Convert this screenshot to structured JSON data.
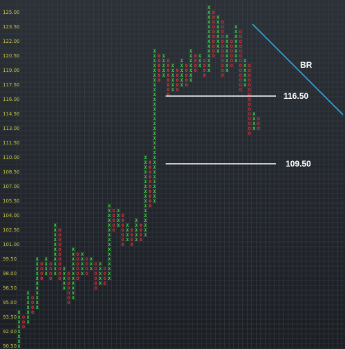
{
  "chart_data": {
    "type": "point-and-figure",
    "title": "",
    "box_size": 0.5,
    "y_ticks": [
      "125.00",
      "123.50",
      "122.00",
      "120.50",
      "119.00",
      "117.50",
      "116.00",
      "114.50",
      "113.00",
      "111.50",
      "110.00",
      "108.50",
      "107.00",
      "105.50",
      "104.00",
      "102.50",
      "101.00",
      "99.50",
      "98.00",
      "96.50",
      "95.00",
      "93.50",
      "92.00",
      "90.50"
    ],
    "columns": [
      {
        "type": "X",
        "low": 90.5,
        "high": 94.0
      },
      {
        "type": "O",
        "low": 92.5,
        "high": 93.5
      },
      {
        "type": "X",
        "low": 93.0,
        "high": 96.0
      },
      {
        "type": "O",
        "low": 94.0,
        "high": 95.5
      },
      {
        "type": "X",
        "low": 94.5,
        "high": 99.5
      },
      {
        "type": "O",
        "low": 97.5,
        "high": 99.0
      },
      {
        "type": "X",
        "low": 98.0,
        "high": 99.5
      },
      {
        "type": "O",
        "low": 97.5,
        "high": 99.0
      },
      {
        "type": "X",
        "low": 98.0,
        "high": 103.0
      },
      {
        "type": "O",
        "low": 97.5,
        "high": 102.5
      },
      {
        "type": "X",
        "low": 96.5,
        "high": 98.5
      },
      {
        "type": "O",
        "low": 95.0,
        "high": 98.0
      },
      {
        "type": "X",
        "low": 95.5,
        "high": 100.5
      },
      {
        "type": "O",
        "low": 97.5,
        "high": 100.0
      },
      {
        "type": "X",
        "low": 98.0,
        "high": 100.0
      },
      {
        "type": "O",
        "low": 98.0,
        "high": 99.5
      },
      {
        "type": "X",
        "low": 98.5,
        "high": 99.5
      },
      {
        "type": "O",
        "low": 96.5,
        "high": 99.0
      },
      {
        "type": "X",
        "low": 97.0,
        "high": 99.0
      },
      {
        "type": "O",
        "low": 97.0,
        "high": 98.5
      },
      {
        "type": "X",
        "low": 97.5,
        "high": 105.0
      },
      {
        "type": "O",
        "low": 102.5,
        "high": 104.5
      },
      {
        "type": "X",
        "low": 103.0,
        "high": 104.5
      },
      {
        "type": "O",
        "low": 101.0,
        "high": 104.0
      },
      {
        "type": "X",
        "low": 101.5,
        "high": 103.0
      },
      {
        "type": "O",
        "low": 101.0,
        "high": 102.5
      },
      {
        "type": "X",
        "low": 101.5,
        "high": 103.5
      },
      {
        "type": "O",
        "low": 101.5,
        "high": 103.0
      },
      {
        "type": "X",
        "low": 102.0,
        "high": 110.0
      },
      {
        "type": "O",
        "low": 105.0,
        "high": 109.5
      },
      {
        "type": "X",
        "low": 105.5,
        "high": 121.0
      },
      {
        "type": "O",
        "low": 118.0,
        "high": 120.5
      },
      {
        "type": "X",
        "low": 118.5,
        "high": 120.5
      },
      {
        "type": "O",
        "low": 116.5,
        "high": 120.0
      },
      {
        "type": "X",
        "low": 117.0,
        "high": 119.5
      },
      {
        "type": "O",
        "low": 117.0,
        "high": 119.0
      },
      {
        "type": "X",
        "low": 117.5,
        "high": 120.0
      },
      {
        "type": "O",
        "low": 117.5,
        "high": 119.5
      },
      {
        "type": "X",
        "low": 118.0,
        "high": 121.0
      },
      {
        "type": "O",
        "low": 119.0,
        "high": 120.5
      },
      {
        "type": "X",
        "low": 119.5,
        "high": 120.5
      },
      {
        "type": "O",
        "low": 118.5,
        "high": 120.0
      },
      {
        "type": "X",
        "low": 119.0,
        "high": 125.5
      },
      {
        "type": "O",
        "low": 120.5,
        "high": 125.0
      },
      {
        "type": "X",
        "low": 121.0,
        "high": 124.5
      },
      {
        "type": "O",
        "low": 118.5,
        "high": 124.0
      },
      {
        "type": "X",
        "low": 119.0,
        "high": 122.5
      },
      {
        "type": "O",
        "low": 119.5,
        "high": 122.0
      },
      {
        "type": "X",
        "low": 120.0,
        "high": 123.5
      },
      {
        "type": "O",
        "low": 117.0,
        "high": 123.0
      },
      {
        "type": "X",
        "low": 117.5,
        "high": 120.0
      },
      {
        "type": "O",
        "low": 112.5,
        "high": 119.5
      },
      {
        "type": "X",
        "low": 113.0,
        "high": 114.5
      },
      {
        "type": "O",
        "low": 113.0,
        "high": 114.0
      }
    ],
    "annotations": [
      {
        "label": "116.50",
        "value": 116.5
      },
      {
        "label": "109.50",
        "value": 109.5
      },
      {
        "label": "BR"
      }
    ],
    "colors": {
      "x_mark": "#3fd64a",
      "o_mark": "#e0323a",
      "tick_label": "#c9c64a",
      "level_line": "#ffffff",
      "trendline": "#3aa6dd",
      "grid": "#3d434b"
    }
  }
}
